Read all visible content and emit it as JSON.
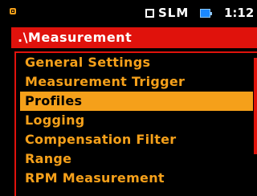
{
  "status_bar": {
    "mode_label": "SLM",
    "clock_text": "1:12"
  },
  "path_bar": {
    "title": ".\\Measurement"
  },
  "menu": {
    "items": [
      {
        "label": "General Settings"
      },
      {
        "label": "Measurement Trigger"
      },
      {
        "label": "Profiles"
      },
      {
        "label": "Logging"
      },
      {
        "label": "Compensation Filter"
      },
      {
        "label": "Range"
      },
      {
        "label": "RPM Measurement"
      }
    ],
    "selected_label": "Profiles"
  },
  "scrollbar": {
    "visible_fraction": 0.7,
    "position_fraction": 0.0
  },
  "colors": {
    "background": "#000000",
    "accent_red": "#e0120c",
    "menu_text": "#f5a01a",
    "highlight": "#f5a01a",
    "highlight_text": "#000000",
    "status_text": "#ffffff",
    "battery": "#1a88ff"
  },
  "icons": {
    "status_left": "device-icon",
    "mode": "mode-box-icon",
    "battery": "battery-icon"
  }
}
